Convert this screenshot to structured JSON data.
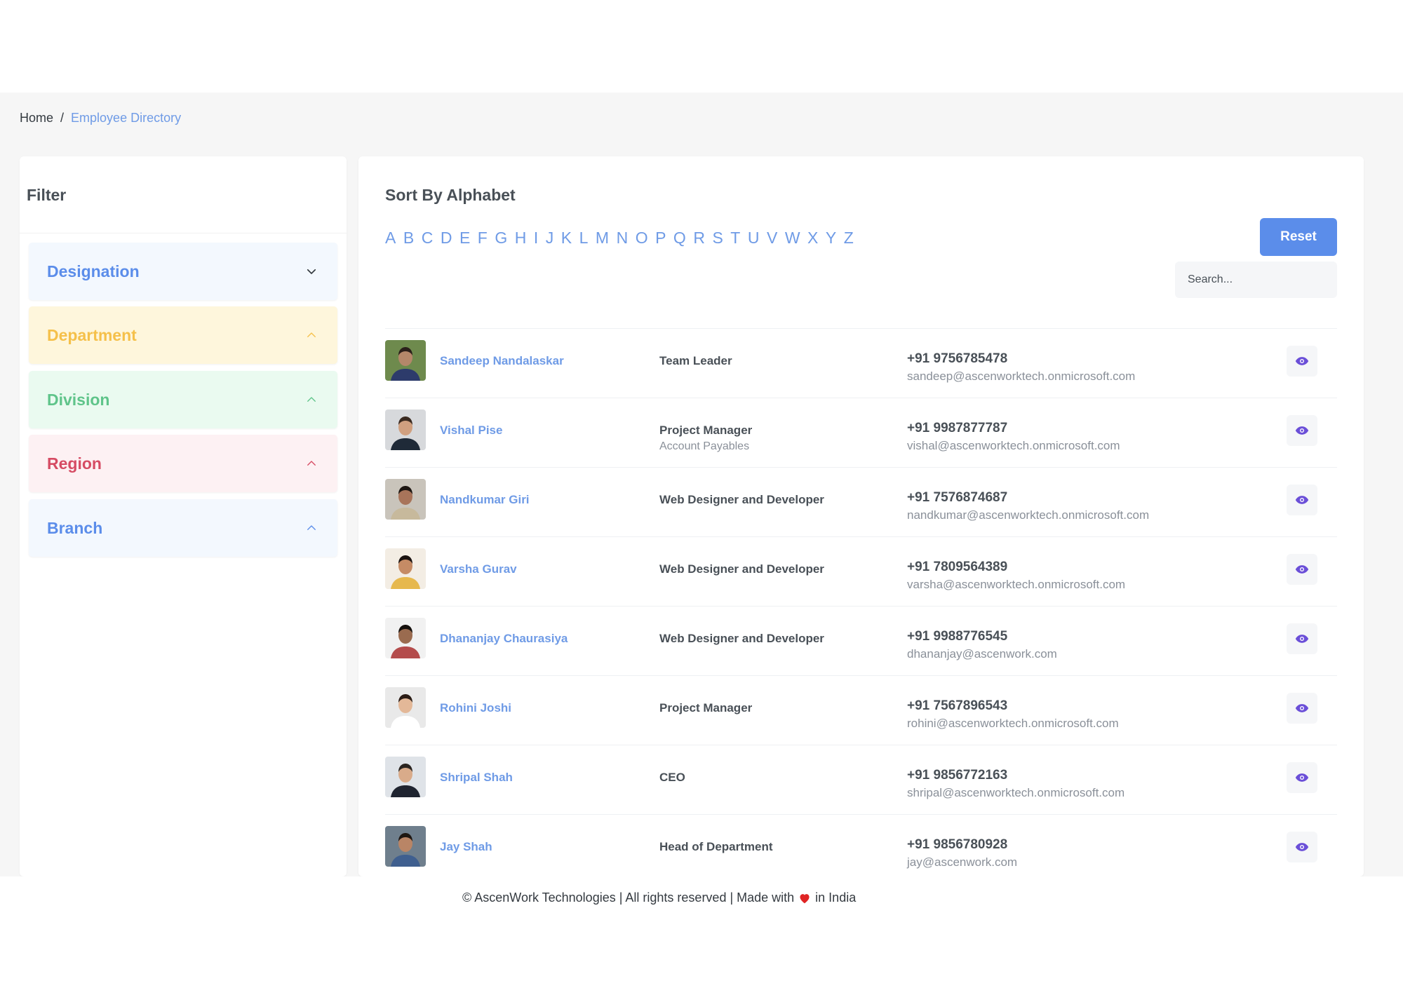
{
  "breadcrumb": {
    "home": "Home",
    "separator": "/",
    "current": "Employee Directory"
  },
  "filter": {
    "title": "Filter",
    "sections": [
      {
        "label": "Designation",
        "state": "collapsed",
        "bg": "#f3f8fe",
        "color": "#5b8dea"
      },
      {
        "label": "Department",
        "state": "expanded",
        "bg": "#fef6dc",
        "color": "#f5c04a"
      },
      {
        "label": "Division",
        "state": "expanded",
        "bg": "#eafaf0",
        "color": "#5fc48a"
      },
      {
        "label": "Region",
        "state": "expanded",
        "bg": "#fdf1f3",
        "color": "#d64b63"
      },
      {
        "label": "Branch",
        "state": "expanded",
        "bg": "#f3f8fe",
        "color": "#5b8dea"
      }
    ]
  },
  "sort": {
    "title": "Sort By Alphabet",
    "letters": [
      "A",
      "B",
      "C",
      "D",
      "E",
      "F",
      "G",
      "H",
      "I",
      "J",
      "K",
      "L",
      "M",
      "N",
      "O",
      "P",
      "Q",
      "R",
      "S",
      "T",
      "U",
      "V",
      "W",
      "X",
      "Y",
      "Z"
    ]
  },
  "reset_label": "Reset",
  "search": {
    "placeholder": "Search...",
    "value": ""
  },
  "employees": [
    {
      "name": "Sandeep Nandalaskar",
      "designation": "Team Leader",
      "department": "",
      "phone": "+91 9756785478",
      "email": "sandeep@ascenworktech.onmicrosoft.com"
    },
    {
      "name": "Vishal Pise",
      "designation": "Project Manager",
      "department": "Account Payables",
      "phone": "+91 9987877787",
      "email": "vishal@ascenworktech.onmicrosoft.com"
    },
    {
      "name": "Nandkumar Giri",
      "designation": "Web Designer and Developer",
      "department": "",
      "phone": "+91 7576874687",
      "email": "nandkumar@ascenworktech.onmicrosoft.com"
    },
    {
      "name": "Varsha Gurav",
      "designation": "Web Designer and Developer",
      "department": "",
      "phone": "+91 7809564389",
      "email": "varsha@ascenworktech.onmicrosoft.com"
    },
    {
      "name": "Dhananjay Chaurasiya",
      "designation": "Web Designer and Developer",
      "department": "",
      "phone": "+91 9988776545",
      "email": "dhananjay@ascenwork.com"
    },
    {
      "name": "Rohini Joshi",
      "designation": "Project Manager",
      "department": "",
      "phone": "+91 7567896543",
      "email": "rohini@ascenworktech.onmicrosoft.com"
    },
    {
      "name": "Shripal Shah",
      "designation": "CEO",
      "department": "",
      "phone": "+91 9856772163",
      "email": "shripal@ascenworktech.onmicrosoft.com"
    },
    {
      "name": "Jay Shah",
      "designation": "Head of Department",
      "department": "",
      "phone": "+91 9856780928",
      "email": "jay@ascenwork.com"
    }
  ],
  "footer": {
    "before": "© AscenWork Technologies | All rights reserved | Made with",
    "after": "in India"
  },
  "colors": {
    "accent": "#5b8dea",
    "link": "#6f9be6",
    "eye": "#6b4fd8",
    "heart": "#e02424"
  },
  "icons": {
    "view": "eye-icon",
    "collapsed": "chevron-down-icon",
    "expanded": "chevron-up-icon",
    "heart": "heart-icon"
  }
}
